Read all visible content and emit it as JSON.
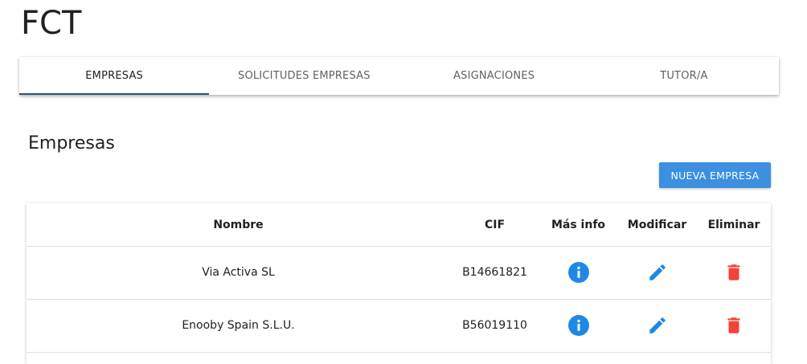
{
  "app": {
    "title": "FCT"
  },
  "tabs": [
    {
      "label": "EMPRESAS",
      "active": true
    },
    {
      "label": "SOLICITUDES EMPRESAS",
      "active": false
    },
    {
      "label": "ASIGNACIONES",
      "active": false
    },
    {
      "label": "TUTOR/A",
      "active": false
    }
  ],
  "section": {
    "title": "Empresas",
    "new_button": "NUEVA EMPRESA"
  },
  "table": {
    "columns": [
      "Nombre",
      "CIF",
      "Más info",
      "Modificar",
      "Eliminar"
    ],
    "rows": [
      {
        "nombre": "Via Activa SL",
        "cif": "B14661821"
      },
      {
        "nombre": "Enooby Spain S.L.U.",
        "cif": "B56019110"
      }
    ]
  },
  "icons": {
    "info": "info-icon",
    "edit": "pencil-icon",
    "delete": "trash-icon"
  },
  "colors": {
    "primary": "#3d8fe0",
    "info": "#1e88e5",
    "delete": "#f44336",
    "tab_indicator": "#1f5a7a"
  }
}
